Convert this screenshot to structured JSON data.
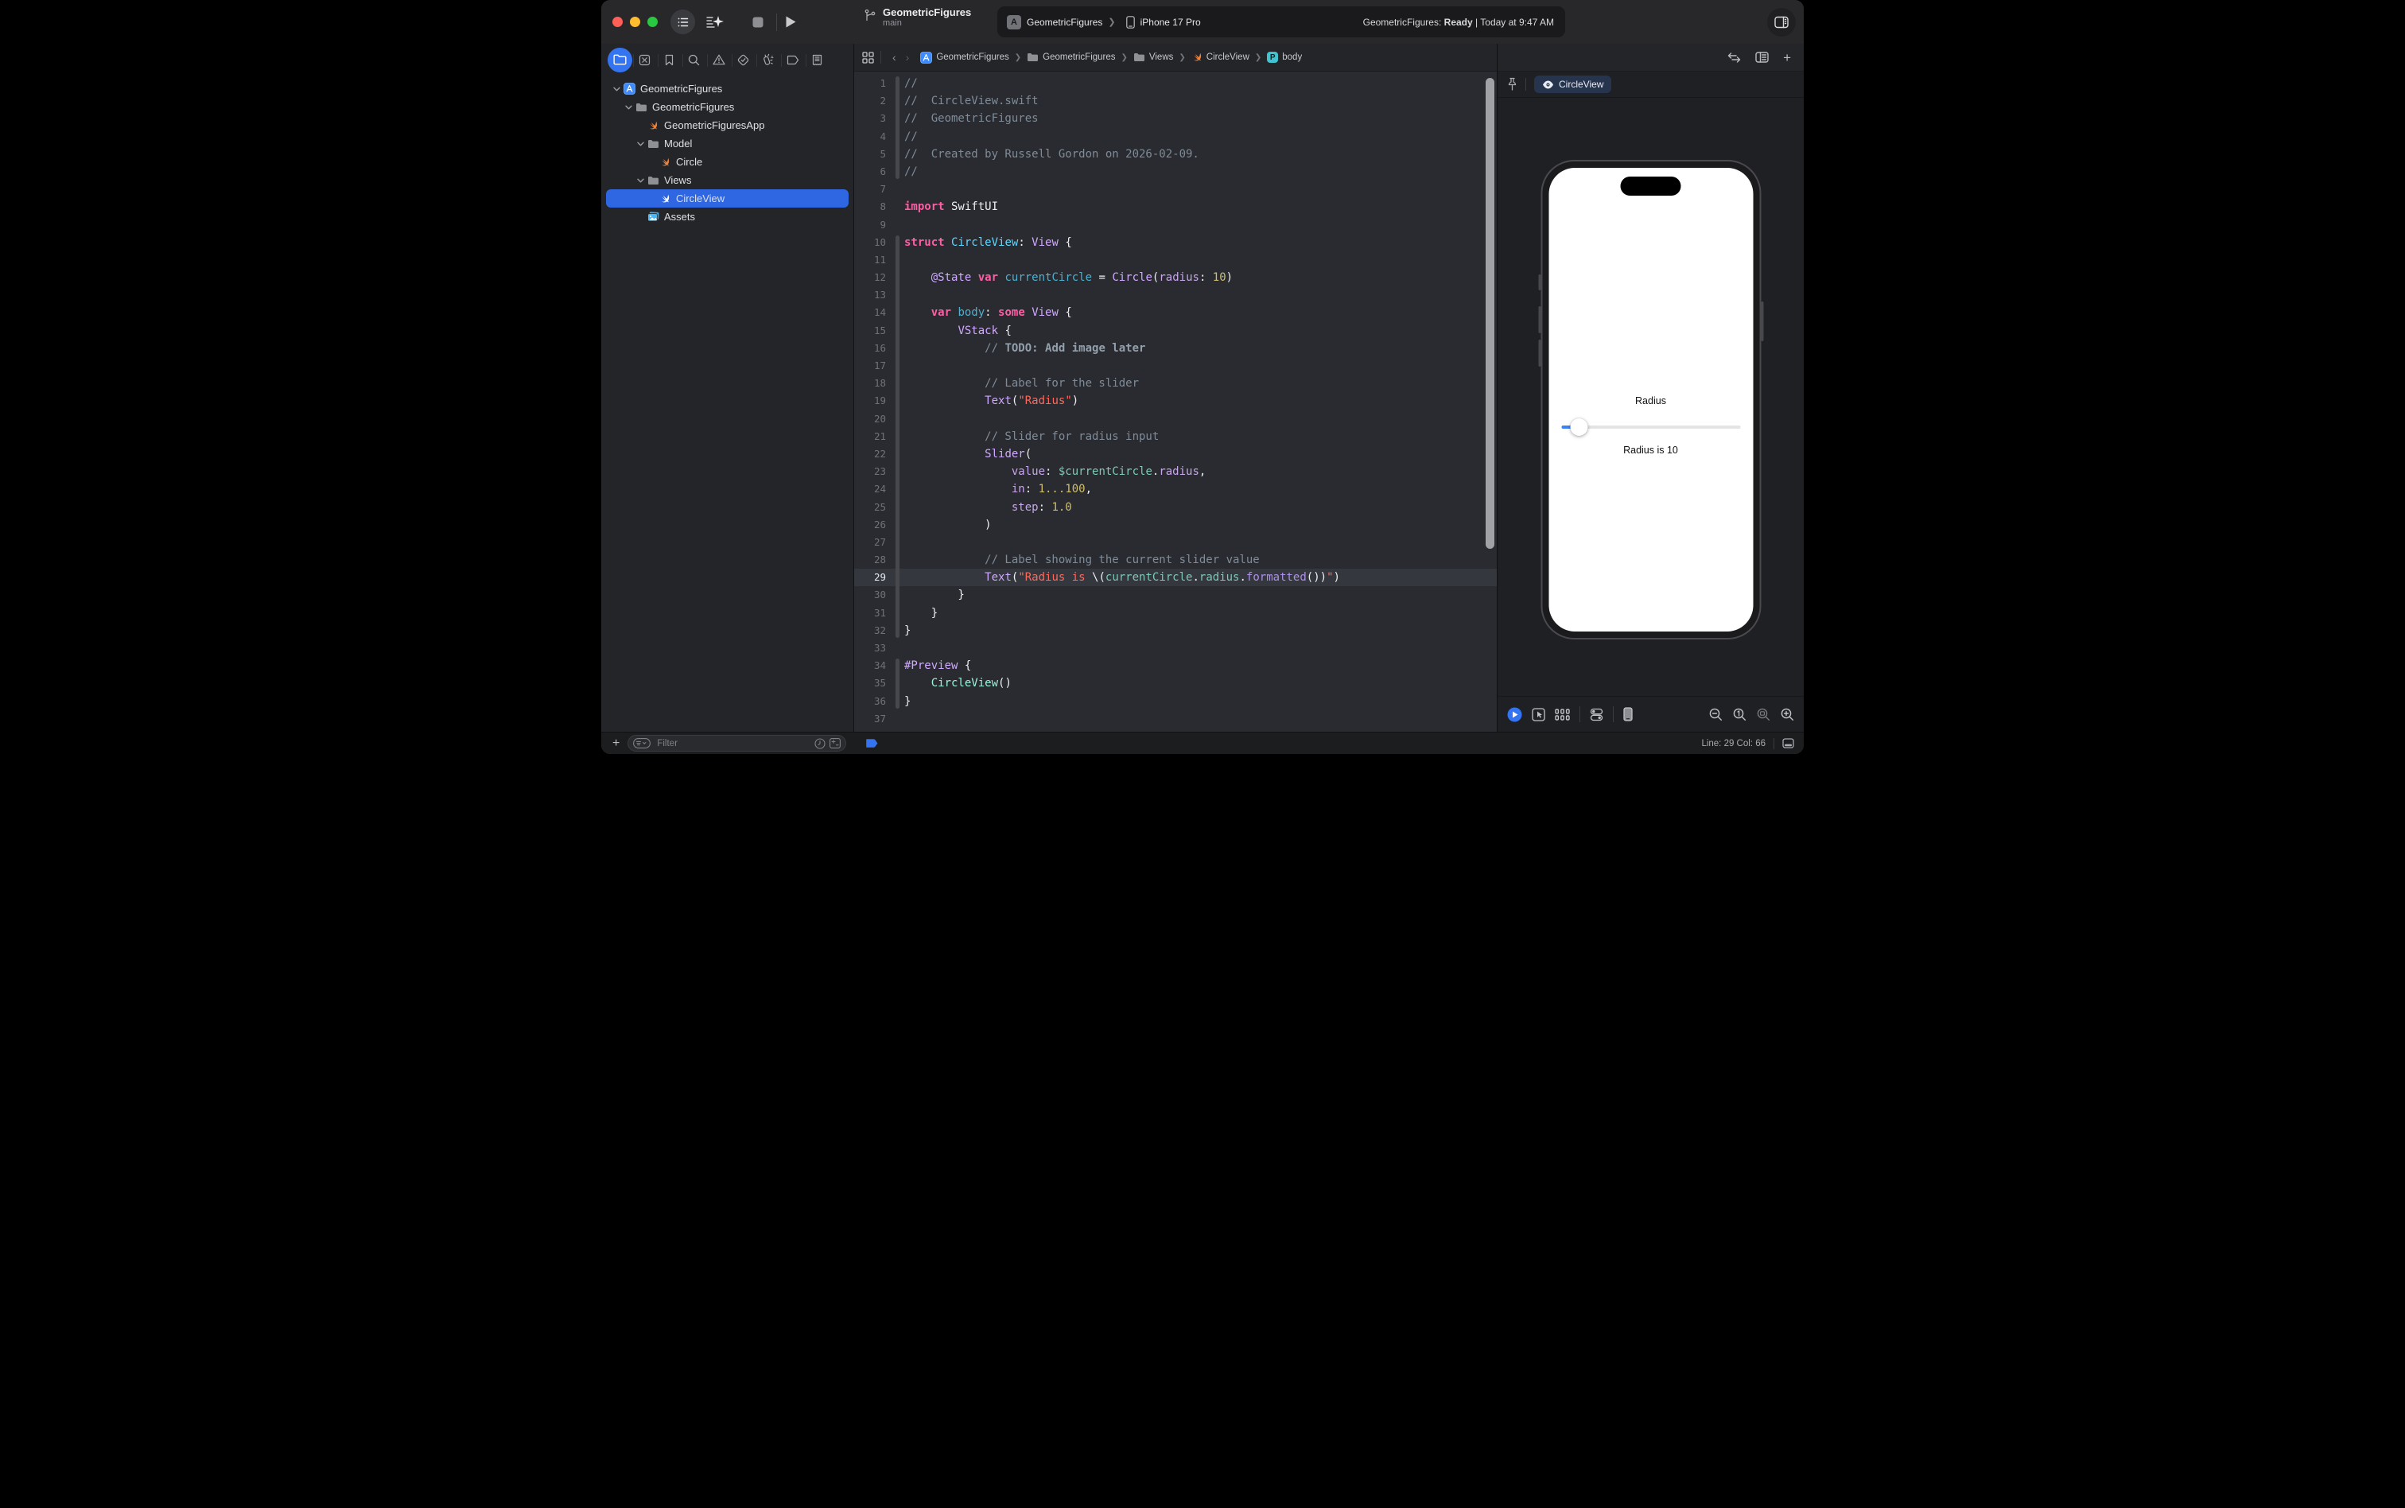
{
  "window": {
    "title": "GeometricFigures",
    "branch": "main"
  },
  "toolbar": {
    "scheme_app": "GeometricFigures",
    "scheme_device": "iPhone 17 Pro",
    "status_app": "GeometricFigures:",
    "status_state": "Ready",
    "status_time": "| Today at 9:47 AM"
  },
  "sidebar": {
    "tabs": [
      "project-navigator",
      "source-control",
      "bookmarks",
      "find",
      "issues",
      "tests",
      "debug",
      "breakpoints",
      "reports"
    ],
    "selected_tab": 0,
    "tree": [
      {
        "label": "GeometricFigures",
        "icon": "project",
        "depth": 0,
        "chevron": true,
        "selected": false
      },
      {
        "label": "GeometricFigures",
        "icon": "folder",
        "depth": 1,
        "chevron": true,
        "selected": false
      },
      {
        "label": "GeometricFiguresApp",
        "icon": "swift",
        "depth": 2,
        "chevron": false,
        "selected": false
      },
      {
        "label": "Model",
        "icon": "folder",
        "depth": 2,
        "chevron": true,
        "selected": false
      },
      {
        "label": "Circle",
        "icon": "swift",
        "depth": 3,
        "chevron": false,
        "selected": false
      },
      {
        "label": "Views",
        "icon": "folder",
        "depth": 2,
        "chevron": true,
        "selected": false
      },
      {
        "label": "CircleView",
        "icon": "swift",
        "depth": 3,
        "chevron": false,
        "selected": true
      },
      {
        "label": "Assets",
        "icon": "assets",
        "depth": 2,
        "chevron": false,
        "selected": false
      }
    ],
    "filter_placeholder": "Filter"
  },
  "jumpbar": {
    "crumbs": [
      {
        "icon": "project",
        "label": "GeometricFigures"
      },
      {
        "icon": "folder",
        "label": "GeometricFigures"
      },
      {
        "icon": "folder",
        "label": "Views"
      },
      {
        "icon": "swift",
        "label": "CircleView"
      },
      {
        "icon": "pbadge",
        "label": "body"
      }
    ]
  },
  "editor": {
    "code": {
      "lines": [
        {
          "n": 1,
          "rb": true,
          "hl": false,
          "seg": [
            [
              "c",
              "//"
            ]
          ]
        },
        {
          "n": 2,
          "rb": true,
          "hl": false,
          "seg": [
            [
              "c",
              "//  CircleView.swift"
            ]
          ]
        },
        {
          "n": 3,
          "rb": true,
          "hl": false,
          "seg": [
            [
              "c",
              "//  GeometricFigures"
            ]
          ]
        },
        {
          "n": 4,
          "rb": true,
          "hl": false,
          "seg": [
            [
              "c",
              "//"
            ]
          ]
        },
        {
          "n": 5,
          "rb": true,
          "hl": false,
          "seg": [
            [
              "c",
              "//  Created by Russell Gordon on 2026-02-09."
            ]
          ]
        },
        {
          "n": 6,
          "rb": true,
          "hl": false,
          "seg": [
            [
              "c",
              "//"
            ]
          ]
        },
        {
          "n": 7,
          "rb": false,
          "hl": false,
          "seg": []
        },
        {
          "n": 8,
          "rb": false,
          "hl": false,
          "seg": [
            [
              "k",
              "import"
            ],
            [
              "p",
              " SwiftUI"
            ]
          ]
        },
        {
          "n": 9,
          "rb": false,
          "hl": false,
          "seg": []
        },
        {
          "n": 10,
          "rb": true,
          "hl": false,
          "seg": [
            [
              "k",
              "struct"
            ],
            [
              "p",
              " "
            ],
            [
              "dt",
              "CircleView"
            ],
            [
              "p",
              ": "
            ],
            [
              "t",
              "View"
            ],
            [
              "p",
              " {"
            ]
          ]
        },
        {
          "n": 11,
          "rb": true,
          "hl": false,
          "seg": []
        },
        {
          "n": 12,
          "rb": true,
          "hl": false,
          "seg": [
            [
              "p",
              "    "
            ],
            [
              "t",
              "@State"
            ],
            [
              "p",
              " "
            ],
            [
              "k",
              "var"
            ],
            [
              "p",
              " "
            ],
            [
              "d",
              "currentCircle"
            ],
            [
              "p",
              " = "
            ],
            [
              "t",
              "Circle"
            ],
            [
              "p",
              "("
            ],
            [
              "l",
              "radius"
            ],
            [
              "p",
              ": "
            ],
            [
              "n",
              "10"
            ],
            [
              "p",
              ")"
            ]
          ]
        },
        {
          "n": 13,
          "rb": true,
          "hl": false,
          "seg": []
        },
        {
          "n": 14,
          "rb": true,
          "hl": false,
          "seg": [
            [
              "p",
              "    "
            ],
            [
              "k",
              "var"
            ],
            [
              "p",
              " "
            ],
            [
              "d",
              "body"
            ],
            [
              "p",
              ": "
            ],
            [
              "k",
              "some"
            ],
            [
              "p",
              " "
            ],
            [
              "t",
              "View"
            ],
            [
              "p",
              " {"
            ]
          ]
        },
        {
          "n": 15,
          "rb": true,
          "hl": false,
          "seg": [
            [
              "p",
              "        "
            ],
            [
              "t",
              "VStack"
            ],
            [
              "p",
              " {"
            ]
          ]
        },
        {
          "n": 16,
          "rb": true,
          "hl": false,
          "seg": [
            [
              "c",
              "            // "
            ],
            [
              "cb",
              "TODO: Add image later"
            ]
          ]
        },
        {
          "n": 17,
          "rb": true,
          "hl": false,
          "seg": []
        },
        {
          "n": 18,
          "rb": true,
          "hl": false,
          "seg": [
            [
              "c",
              "            // Label for the slider"
            ]
          ]
        },
        {
          "n": 19,
          "rb": true,
          "hl": false,
          "seg": [
            [
              "p",
              "            "
            ],
            [
              "t",
              "Text"
            ],
            [
              "p",
              "("
            ],
            [
              "s",
              "\"Radius\""
            ],
            [
              "p",
              ")"
            ]
          ]
        },
        {
          "n": 20,
          "rb": true,
          "hl": false,
          "seg": []
        },
        {
          "n": 21,
          "rb": true,
          "hl": false,
          "seg": [
            [
              "c",
              "            // Slider for radius input"
            ]
          ]
        },
        {
          "n": 22,
          "rb": true,
          "hl": false,
          "seg": [
            [
              "p",
              "            "
            ],
            [
              "t",
              "Slider"
            ],
            [
              "p",
              "("
            ]
          ]
        },
        {
          "n": 23,
          "rb": true,
          "hl": false,
          "seg": [
            [
              "p",
              "                "
            ],
            [
              "l",
              "value"
            ],
            [
              "p",
              ": "
            ],
            [
              "m",
              "$currentCircle"
            ],
            [
              "p",
              "."
            ],
            [
              "l",
              "radius"
            ],
            [
              "p",
              ","
            ]
          ]
        },
        {
          "n": 24,
          "rb": true,
          "hl": false,
          "seg": [
            [
              "p",
              "                "
            ],
            [
              "l",
              "in"
            ],
            [
              "p",
              ": "
            ],
            [
              "n",
              "1...100"
            ],
            [
              "p",
              ","
            ]
          ]
        },
        {
          "n": 25,
          "rb": true,
          "hl": false,
          "seg": [
            [
              "p",
              "                "
            ],
            [
              "l",
              "step"
            ],
            [
              "p",
              ": "
            ],
            [
              "n",
              "1.0"
            ]
          ]
        },
        {
          "n": 26,
          "rb": true,
          "hl": false,
          "seg": [
            [
              "p",
              "            )"
            ]
          ]
        },
        {
          "n": 27,
          "rb": true,
          "hl": false,
          "seg": []
        },
        {
          "n": 28,
          "rb": true,
          "hl": false,
          "seg": [
            [
              "c",
              "            // Label showing the current slider value"
            ]
          ]
        },
        {
          "n": 29,
          "rb": true,
          "hl": true,
          "seg": [
            [
              "p",
              "            "
            ],
            [
              "t",
              "Text"
            ],
            [
              "p",
              "("
            ],
            [
              "s",
              "\"Radius is "
            ],
            [
              "p",
              "\\("
            ],
            [
              "m",
              "currentCircle"
            ],
            [
              "p",
              "."
            ],
            [
              "m",
              "radius"
            ],
            [
              "p",
              "."
            ],
            [
              "f",
              "formatted"
            ],
            [
              "p",
              "())"
            ],
            [
              "s",
              "\""
            ],
            [
              "p",
              ")"
            ]
          ]
        },
        {
          "n": 30,
          "rb": true,
          "hl": false,
          "seg": [
            [
              "p",
              "        }"
            ]
          ]
        },
        {
          "n": 31,
          "rb": true,
          "hl": false,
          "seg": [
            [
              "p",
              "    }"
            ]
          ]
        },
        {
          "n": 32,
          "rb": true,
          "hl": false,
          "seg": [
            [
              "p",
              "}"
            ]
          ]
        },
        {
          "n": 33,
          "rb": false,
          "hl": false,
          "seg": []
        },
        {
          "n": 34,
          "rb": true,
          "hl": false,
          "seg": [
            [
              "t",
              "#Preview"
            ],
            [
              "p",
              " {"
            ]
          ]
        },
        {
          "n": 35,
          "rb": true,
          "hl": false,
          "seg": [
            [
              "p",
              "    "
            ],
            [
              "mb",
              "CircleView"
            ],
            [
              "p",
              "()"
            ]
          ]
        },
        {
          "n": 36,
          "rb": true,
          "hl": false,
          "seg": [
            [
              "p",
              "}"
            ]
          ]
        },
        {
          "n": 37,
          "rb": false,
          "hl": false,
          "seg": []
        }
      ]
    }
  },
  "canvas": {
    "pin_label": "CircleView"
  },
  "preview": {
    "label_title": "Radius",
    "label_value": "Radius is 10",
    "slider_pct": 10
  },
  "statusbar": {
    "line_col": "Line: 29  Col: 66"
  },
  "colors": {
    "accent_blue": "#3574F0",
    "selection_blue": "#2F66E2",
    "slider_blue": "#3B82F7",
    "keyword_pink": "#FC5FA3",
    "type_lavender": "#D0A8FF",
    "decl_cyan": "#5DD8FF",
    "decl_teal": "#4EB0CE",
    "project_mint": "#7EC8B4",
    "string_salmon": "#FC6A5D",
    "number_yellow": "#D0BF69",
    "comment_gray": "#7F8C98",
    "swift_orange": "#F28237"
  }
}
